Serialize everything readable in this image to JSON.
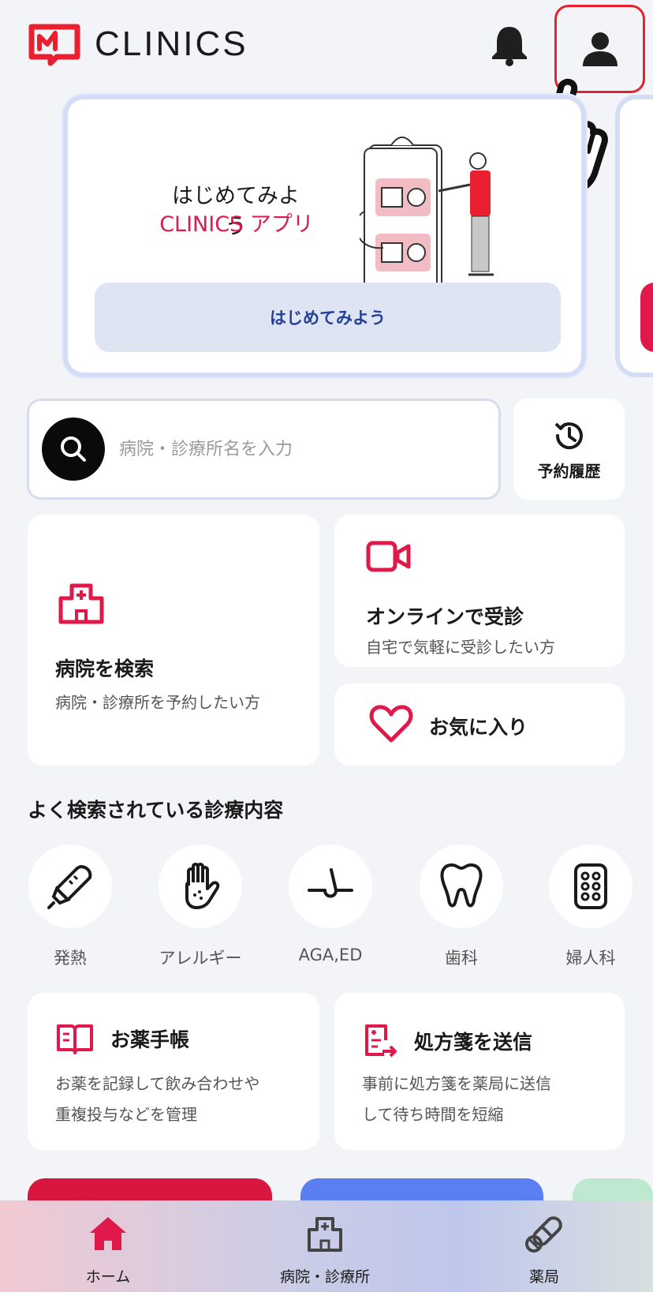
{
  "header": {
    "app_name": "CLINICS",
    "icons": [
      "logo-icon",
      "bell-icon",
      "person-icon",
      "pointing-hand-icon"
    ]
  },
  "promo": {
    "title_line1": "はじめてみよう",
    "title_line2": "CLINICS アプリ",
    "button_label": "はじめてみよう"
  },
  "search": {
    "placeholder": "病院・診療所名を入力",
    "history_label": "予約履歴"
  },
  "tiles": {
    "hospital": {
      "title": "病院を検索",
      "subtitle": "病院・診療所を予約したい方"
    },
    "online": {
      "title": "オンラインで受診",
      "subtitle": "自宅で気軽に受診したい方"
    },
    "favorites": {
      "title": "お気に入り"
    }
  },
  "categories": {
    "section_title": "よく検索されている診療内容",
    "items": [
      {
        "label": "発熱",
        "icon": "thermometer-icon"
      },
      {
        "label": "アレルギー",
        "icon": "hand-icon"
      },
      {
        "label": "AGA,ED",
        "icon": "hair-icon"
      },
      {
        "label": "歯科",
        "icon": "tooth-icon"
      },
      {
        "label": "婦人科",
        "icon": "pill-pack-icon"
      }
    ]
  },
  "tools": {
    "medicine_notebook": {
      "title": "お薬手帳",
      "desc_line1": "お薬を記録して飲み合わせや",
      "desc_line2": "重複投与などを管理"
    },
    "prescription": {
      "title": "処方箋を送信",
      "desc_line1": "事前に処方箋を薬局に送信",
      "desc_line2": "して待ち時間を短縮"
    }
  },
  "banners": [
    {
      "color": "#d8163f"
    },
    {
      "color": "#5b7ef0"
    },
    {
      "color": "#bfe8d0"
    }
  ],
  "tabbar": {
    "items": [
      {
        "label": "ホーム",
        "icon": "home-icon",
        "active": true
      },
      {
        "label": "病院・診療所",
        "icon": "hospital-icon",
        "active": false
      },
      {
        "label": "薬局",
        "icon": "pill-icon",
        "active": false
      }
    ]
  },
  "colors": {
    "accent": "#e0194b",
    "highlight_border": "#e8202f",
    "background": "#f3f4f7",
    "promo_button_text": "#23419a"
  }
}
